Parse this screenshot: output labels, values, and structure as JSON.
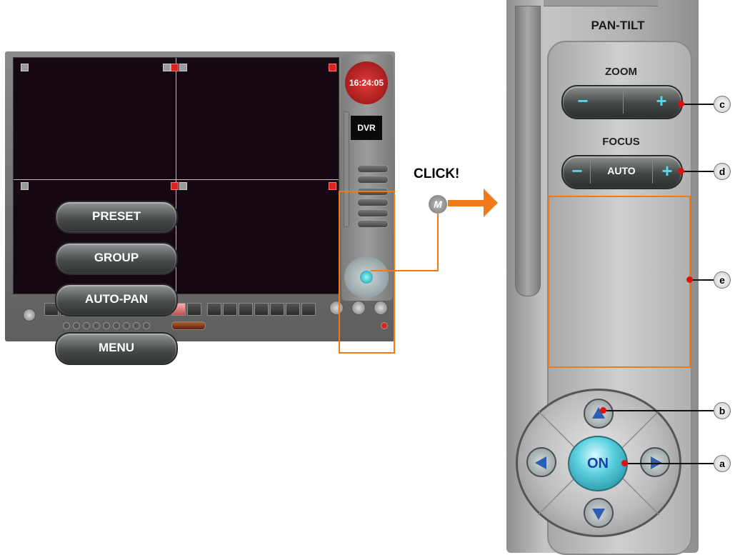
{
  "annotation": {
    "click_label": "CLICK!",
    "m_badge": "M"
  },
  "dvr_window": {
    "clock_time": "16:24:05",
    "logo": "DVR",
    "panel_title": "PAN-TILT"
  },
  "ptz_panel": {
    "title": "PAN-TILT",
    "zoom": {
      "label": "ZOOM",
      "minus": "−",
      "plus": "+"
    },
    "focus": {
      "label": "FOCUS",
      "minus": "−",
      "auto": "AUTO",
      "plus": "+"
    },
    "menu_buttons": [
      "PRESET",
      "GROUP",
      "AUTO-PAN",
      "MENU"
    ],
    "on_button": "ON"
  },
  "callouts": {
    "a": "a",
    "b": "b",
    "c": "c",
    "d": "d",
    "e": "e"
  },
  "colors": {
    "accent_orange": "#f07a1a",
    "callout_red": "#e01010",
    "on_cyan": "#5ad0df"
  }
}
